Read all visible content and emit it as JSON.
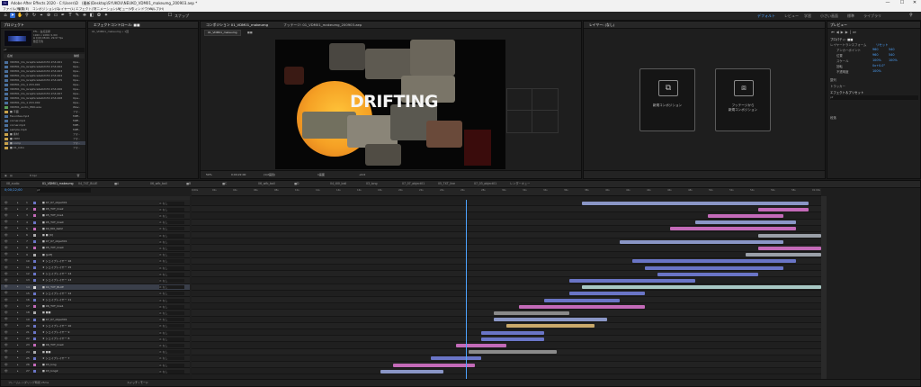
{
  "app": {
    "title": "Adobe After Effects 2020 - C:\\Users\\D　(最新)Desktop\\SYUKOU\\NEUKO_VDM01_makeumg_200903.aep *",
    "logo_text": "Ae",
    "window_controls": [
      "—",
      "☐",
      "✕"
    ]
  },
  "menu": [
    "ファイル(F)",
    "編集(E)",
    "コンポジション(C)",
    "レイヤー(L)",
    "エフェクト(T)",
    "アニメーション(A)",
    "ビュー(V)",
    "ウィンドウ(W)",
    "ヘルプ(H)"
  ],
  "toolbar": {
    "snap_label": "スナップ",
    "workspaces": [
      "デフォルト",
      "レビュー",
      "学習",
      "小さい画面",
      "標準",
      "ライブラリ"
    ],
    "active_workspace_index": 0
  },
  "project_panel": {
    "tab": "プロジェクト",
    "preview_info": [
      "FFL - 白点蓝绿",
      "1920 x 1080 (1.00)",
      "Δ 0;00;08;00, 29.97 fps",
      "数百万色"
    ],
    "search_placeholder": "ρ▾",
    "col_name": "名前",
    "col_type": "種類",
    "items": [
      {
        "name": "VDM01_CG_Graphics4a0215h 2h3-001",
        "type": "Ope.."
      },
      {
        "name": "VDM01_CG_Graphics4a0215h 2h3-002",
        "type": "Ope.."
      },
      {
        "name": "VDM01_CG_Graphics4a0215h 2h3-003",
        "type": "Ope.."
      },
      {
        "name": "VDM01_CG_Graphics4a0215h 2h3-004",
        "type": "Ope.."
      },
      {
        "name": "VDM01_CG_Graphics4a0215h 2h3-005",
        "type": "Ope.."
      },
      {
        "name": "VDM01_CG_1 2h3-001",
        "type": "Ope.."
      },
      {
        "name": "VDM01_CG_Graphics4a0215h 2h3-006",
        "type": "Ope.."
      },
      {
        "name": "VDM01_CG_Graphics4a0215h 2h3-007",
        "type": "Ope.."
      },
      {
        "name": "VDM01_CG_Graphics4a0215h 2h3-008",
        "type": "Ope.."
      },
      {
        "name": "VDM01_CG_1 2h3-002",
        "type": "Ope.."
      },
      {
        "name": "VDM01_audio_PRO.wav",
        "type": "Wav.."
      },
      {
        "name": "■ 平面",
        "type": "フォ.."
      },
      {
        "name": "Favorites.mp4",
        "type": "MPE.."
      },
      {
        "name": "corner.mp4",
        "type": "MPE.."
      },
      {
        "name": "corner.mp4",
        "type": "MPE.."
      },
      {
        "name": "sample.mp4",
        "type": "MPE.."
      },
      {
        "name": "■ 素材",
        "type": "フォ.."
      },
      {
        "name": "■ VDM",
        "type": "フォ.."
      },
      {
        "name": "■ comp",
        "type": "フォ.."
      },
      {
        "name": "■ 01_Intro",
        "type": "フォ.."
      }
    ],
    "footer": "8 bpc"
  },
  "effects_panel": {
    "tab": "エフェクトコントロール: ■■",
    "subtitle": "01_VDM01_makeumg • 1回"
  },
  "composition_panel": {
    "tab": "コンポジション 01_VDM01_makeumg",
    "footage_tab": "フッテージ: 01_VDM01_makeumg_200903.aep",
    "breadcrumb": "01_VDM01_makeumg",
    "breadcrumb2": "■■",
    "viewer_text": "DRIFTING",
    "zoom": "50%",
    "timecode": "0;00;22;00",
    "quality": "(1/2画質)",
    "magnification": "1画面",
    "exposure": "+0.0"
  },
  "layer_panel": {
    "tab": "レイヤー: (なし)",
    "new_comp": "新規コンポジション",
    "new_comp_from_footage": "フッテージから\n新規コンポジション"
  },
  "right_panels": {
    "preview_tab": "プレビュー",
    "properties_tab": "プロパティ: ■■",
    "layer_transform": "レイヤートランスフォーム",
    "reset": "リセット",
    "props": [
      {
        "name": "アンカーポイント",
        "v1": "960",
        "v2": "540"
      },
      {
        "name": "位置",
        "v1": "960",
        "v2": "540"
      },
      {
        "name": "スケール",
        "v1": "100%",
        "v2": "100%"
      },
      {
        "name": "回転",
        "v1": "0x+0.0°",
        "v2": ""
      },
      {
        "name": "不透明度",
        "v1": "100%",
        "v2": ""
      }
    ],
    "align_tab": "整列",
    "tracker_tab": "トラッカー",
    "effects_presets_tab": "エフェクト＆プリセット",
    "search_placeholder": "ρ▾",
    "paragraph_tab": "段落"
  },
  "timeline": {
    "tabs": [
      "08_audio",
      "01_VDM01_makeumg",
      "04_TXT_BLUE",
      "■A",
      "06_wfb_ball",
      "■B",
      "■C",
      "06_wfb_ball",
      "■D",
      "04_t00_ball",
      "03_long",
      "07_07_object01",
      "05_TXT_line",
      "07_03_object01",
      "レンダーキュー"
    ],
    "selected_tab_index": 1,
    "current_time": "0;00;22;00",
    "search_placeholder": "ρ▾",
    "ruler_labels": [
      "0;00s",
      "02s",
      "04s",
      "06s",
      "08s",
      "10s",
      "12s",
      "14s",
      "16s",
      "18s",
      "20s",
      "22s",
      "24s",
      "26s",
      "28s",
      "30s",
      "32s",
      "34s",
      "36s",
      "38s",
      "40s",
      "42s",
      "44s",
      "46s",
      "48s",
      "50s",
      "52s",
      "54s",
      "56s",
      "58s",
      "01:00s"
    ],
    "playhead_fraction": 0.435,
    "layers": [
      {
        "num": "1",
        "name": "■ 07_07_object01",
        "color": "#6a75c6",
        "bar_color": "#8a96c6",
        "bar_start": 0.62,
        "bar_end": 0.98
      },
      {
        "num": "2",
        "name": "■ 05_TXT_line2",
        "color": "#c36ab8",
        "bar_color": "#c36ab8",
        "bar_start": 0.9,
        "bar_end": 0.98
      },
      {
        "num": "3",
        "name": "■ 05_TXT_line1",
        "color": "#c36ab8",
        "bar_color": "#c36ab8",
        "bar_start": 0.82,
        "bar_end": 0.94
      },
      {
        "num": "4",
        "name": "■ 05_TXT_line0",
        "color": "#6a75c6",
        "bar_color": "#8a96c6",
        "bar_start": 0.8,
        "bar_end": 0.96
      },
      {
        "num": "5",
        "name": "■ 04_t00_ball2",
        "color": "#c36ab8",
        "bar_color": "#c36ab8",
        "bar_start": 0.76,
        "bar_end": 0.96
      },
      {
        "num": "6",
        "name": "■ ■ [0]",
        "color": "#aaaaaa",
        "bar_color": "#9aa0a8",
        "bar_start": 0.9,
        "bar_end": 1.0
      },
      {
        "num": "7",
        "name": "■ 07_07_object01",
        "color": "#6a75c6",
        "bar_color": "#8a96c6",
        "bar_start": 0.68,
        "bar_end": 0.94
      },
      {
        "num": "8",
        "name": "■ 05_TXT_line0",
        "color": "#c36ab8",
        "bar_color": "#c36ab8",
        "bar_start": 0.9,
        "bar_end": 1.0
      },
      {
        "num": "9",
        "name": "■ [pdf]",
        "color": "#aaaaaa",
        "bar_color": "#9aa0a8",
        "bar_start": 0.88,
        "bar_end": 1.0
      },
      {
        "num": "10",
        "name": "★ シェイプレイヤー 16",
        "color": "#6a75c6",
        "bar_color": "#6a75c6",
        "bar_start": 0.7,
        "bar_end": 0.96
      },
      {
        "num": "11",
        "name": "★ シェイプレイヤー 15",
        "color": "#6a75c6",
        "bar_color": "#6a75c6",
        "bar_start": 0.72,
        "bar_end": 0.94
      },
      {
        "num": "12",
        "name": "★ シェイプレイヤー 14",
        "color": "#6a75c6",
        "bar_color": "#6a75c6",
        "bar_start": 0.74,
        "bar_end": 0.9
      },
      {
        "num": "13",
        "name": "★ シェイプレイヤー 13",
        "color": "#6a75c6",
        "bar_color": "#6a75c6",
        "bar_start": 0.6,
        "bar_end": 0.8
      },
      {
        "num": "14",
        "name": "■ 04_TXT_BLUE",
        "color": "#d9d9d9",
        "bar_color": "#a8c8c4",
        "bar_start": 0.62,
        "bar_end": 1.0
      },
      {
        "num": "15",
        "name": "★ シェイプレイヤー 12",
        "color": "#6a75c6",
        "bar_color": "#6a75c6",
        "bar_start": 0.6,
        "bar_end": 0.72
      },
      {
        "num": "16",
        "name": "★ シェイプレイヤー 11",
        "color": "#6a75c6",
        "bar_color": "#6a75c6",
        "bar_start": 0.56,
        "bar_end": 0.68
      },
      {
        "num": "17",
        "name": "■ 06_TXT_line1",
        "color": "#c36ab8",
        "bar_color": "#c36ab8",
        "bar_start": 0.52,
        "bar_end": 0.72
      },
      {
        "num": "18",
        "name": "■ ■■",
        "color": "#aaaaaa",
        "bar_color": "#8a8a8a",
        "bar_start": 0.48,
        "bar_end": 0.6
      },
      {
        "num": "19",
        "name": "■ 07_07_object01",
        "color": "#6a75c6",
        "bar_color": "#8a96c6",
        "bar_start": 0.48,
        "bar_end": 0.66
      },
      {
        "num": "20",
        "name": "★ シェイプレイヤー 10",
        "color": "#6a75c6",
        "bar_color": "#c9a86a",
        "bar_start": 0.5,
        "bar_end": 0.64
      },
      {
        "num": "21",
        "name": "★ シェイプレイヤー 9",
        "color": "#6a75c6",
        "bar_color": "#6a75c6",
        "bar_start": 0.46,
        "bar_end": 0.56
      },
      {
        "num": "22",
        "name": "★ シェイプレイヤー 8",
        "color": "#6a75c6",
        "bar_color": "#6a75c6",
        "bar_start": 0.46,
        "bar_end": 0.56
      },
      {
        "num": "23",
        "name": "■ 06_TXT_line0",
        "color": "#c36ab8",
        "bar_color": "#c36ab8",
        "bar_start": 0.42,
        "bar_end": 0.5
      },
      {
        "num": "24",
        "name": "■ ■■",
        "color": "#aaaaaa",
        "bar_color": "#8a8a8a",
        "bar_start": 0.44,
        "bar_end": 0.58
      },
      {
        "num": "25",
        "name": "★ シェイプレイヤー 7",
        "color": "#6a75c6",
        "bar_color": "#6a75c6",
        "bar_start": 0.38,
        "bar_end": 0.46
      },
      {
        "num": "26",
        "name": "■ 03_long",
        "color": "#c36ab8",
        "bar_color": "#c36ab8",
        "bar_start": 0.32,
        "bar_end": 0.45
      },
      {
        "num": "27",
        "name": "■ 03_long2",
        "color": "#6a75c6",
        "bar_color": "#8a96c6",
        "bar_start": 0.3,
        "bar_end": 0.4
      }
    ],
    "footer": "フレームレンダリング時間 25ms",
    "toggle_label": "スイッチ / モード"
  }
}
